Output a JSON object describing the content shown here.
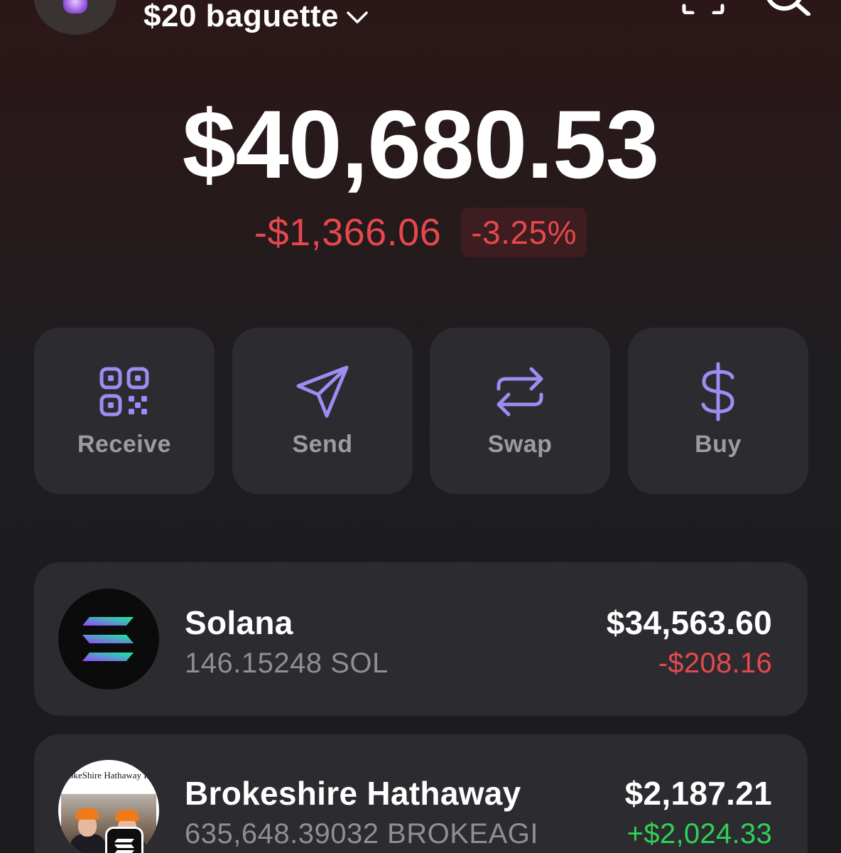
{
  "header": {
    "account_name": "$20 baguette",
    "avatar_icon": "crystal-ball-icon",
    "scan_icon": "scan-icon",
    "search_icon": "search-icon"
  },
  "portfolio": {
    "balance": "$40,680.53",
    "change_amount": "-$1,366.06",
    "change_percent": "-3.25%"
  },
  "actions": [
    {
      "label": "Receive",
      "icon": "qr-code-icon"
    },
    {
      "label": "Send",
      "icon": "send-icon"
    },
    {
      "label": "Swap",
      "icon": "swap-icon"
    },
    {
      "label": "Buy",
      "icon": "dollar-icon"
    }
  ],
  "tokens": [
    {
      "name": "Solana",
      "quantity": "146.15248 SOL",
      "value": "$34,563.60",
      "change": "-$208.16",
      "icon": "solana-icon"
    },
    {
      "name": "Brokeshire Hathaway",
      "quantity": "635,648.39032 BROKEAGI",
      "value": "$2,187.21",
      "change": "+$2,024.33",
      "icon": "brokeshire-hathaway-icon",
      "icon_text": "BrokeShire Hathaway Inc."
    }
  ],
  "colors": {
    "accent": "#9d8cf2",
    "negative": "#e5484d",
    "positive": "#30d158",
    "card": "#2c2c30"
  }
}
